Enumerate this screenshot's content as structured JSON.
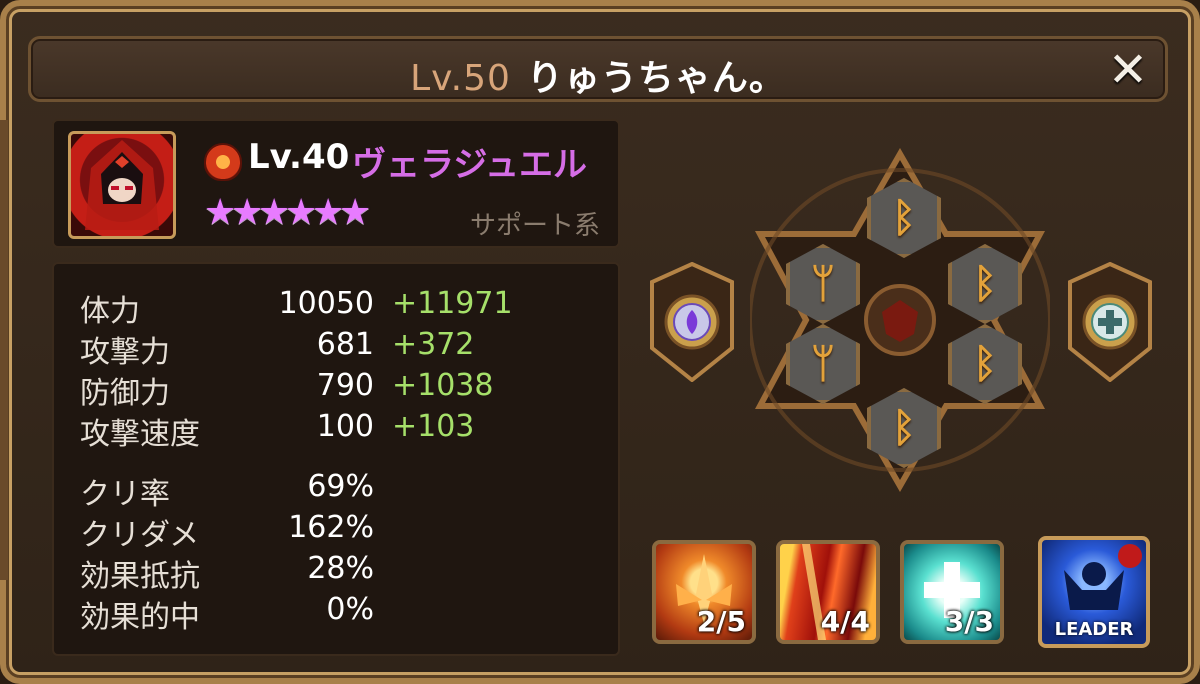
{
  "title": {
    "level": "Lv.50",
    "name": "りゅうちゃん。"
  },
  "close_icon": "close-icon",
  "monster": {
    "level": "Lv.40",
    "name": "ヴェラジュエル",
    "type": "サポート系",
    "stars": 6,
    "element_icon": "fire-element-icon",
    "star_glyph": "★"
  },
  "stats": [
    {
      "label": "体力",
      "base": "10050",
      "bonus": "+11971"
    },
    {
      "label": "攻撃力",
      "base": "681",
      "bonus": "+372"
    },
    {
      "label": "防御力",
      "base": "790",
      "bonus": "+1038"
    },
    {
      "label": "攻撃速度",
      "base": "100",
      "bonus": "+103"
    },
    {
      "label": "クリ率",
      "base": "69%",
      "bonus": ""
    },
    {
      "label": "クリダメ",
      "base": "162%",
      "bonus": ""
    },
    {
      "label": "効果抵抗",
      "base": "28%",
      "bonus": ""
    },
    {
      "label": "効果的中",
      "base": "0%",
      "bonus": ""
    }
  ],
  "runes": [
    {
      "slot": 1,
      "glyph": "ᛒ",
      "set_icon": "violent-rune-icon"
    },
    {
      "slot": 2,
      "glyph": "ᛒ",
      "set_icon": "violent-rune-icon"
    },
    {
      "slot": 3,
      "glyph": "ᛒ",
      "set_icon": "violent-rune-icon"
    },
    {
      "slot": 4,
      "glyph": "ᛒ",
      "set_icon": "violent-rune-icon"
    },
    {
      "slot": 5,
      "glyph": "ᛘ",
      "set_icon": "energy-rune-icon"
    },
    {
      "slot": 6,
      "glyph": "ᛘ",
      "set_icon": "energy-rune-icon"
    }
  ],
  "artifacts": [
    {
      "side": "left",
      "icon": "element-artifact-icon"
    },
    {
      "side": "right",
      "icon": "type-artifact-icon"
    }
  ],
  "skills": [
    {
      "level": "2/5",
      "icon": "skill-1-icon"
    },
    {
      "level": "4/4",
      "icon": "skill-2-icon"
    },
    {
      "level": "3/3",
      "icon": "heal-skill-icon"
    }
  ],
  "leader_skill": {
    "label": "LEADER"
  },
  "colors": {
    "frame": "#a8804a",
    "panel": "#1f1610",
    "name_pink": "#d56de6",
    "bonus_green": "#a6e06a",
    "rune_glyph": "#e3a23a"
  }
}
